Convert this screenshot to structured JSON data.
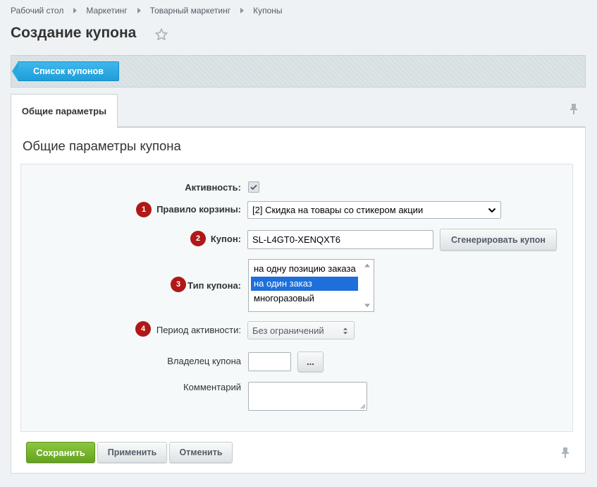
{
  "breadcrumbs": [
    "Рабочий стол",
    "Маркетинг",
    "Товарный маркетинг",
    "Купоны"
  ],
  "page_title": "Создание купона",
  "toolbar": {
    "list_button": "Список купонов"
  },
  "tabs": [
    {
      "label": "Общие параметры"
    }
  ],
  "section_title": "Общие параметры купона",
  "form": {
    "active": {
      "label": "Активность:",
      "checked": true
    },
    "basket_rule": {
      "badge": "1",
      "label": "Правило корзины:",
      "value": "[2] Скидка на товары со стикером акции"
    },
    "coupon": {
      "badge": "2",
      "label": "Купон:",
      "value": "SL-L4GT0-XENQXT6",
      "generate_button": "Сгенерировать купон"
    },
    "coupon_type": {
      "badge": "3",
      "label": "Тип купона:",
      "options": [
        "на одну позицию заказа",
        "на один заказ",
        "многоразовый"
      ],
      "selected": "на один заказ"
    },
    "period": {
      "badge": "4",
      "label": "Период активности:",
      "value": "Без ограничений"
    },
    "owner": {
      "label": "Владелец купона",
      "value": "",
      "picker_button": "..."
    },
    "comment": {
      "label": "Комментарий",
      "value": ""
    }
  },
  "buttons": {
    "save": "Сохранить",
    "apply": "Применить",
    "cancel": "Отменить"
  },
  "colors": {
    "accent_blue": "#1d9ed9",
    "save_green": "#76b52a",
    "badge_red": "#b01818",
    "selection_blue": "#1e6fd9"
  }
}
